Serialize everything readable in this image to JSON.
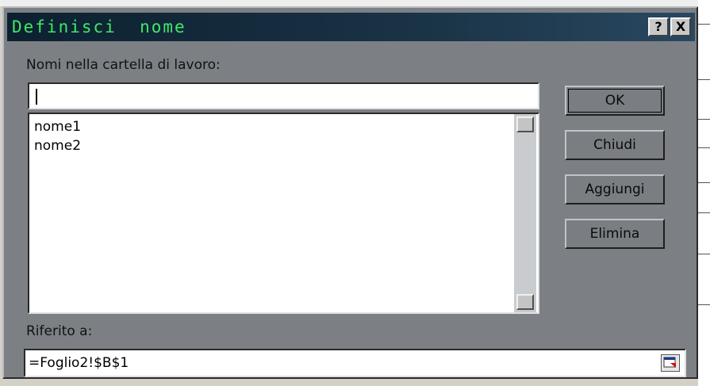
{
  "dialog": {
    "title": "Definisci  nome",
    "help_label": "?",
    "close_label": "X",
    "names_label": "Nomi nella cartella di lavoro:",
    "name_input_value": "",
    "names": [
      "nome1",
      "nome2"
    ],
    "refers_label": "Riferito a:",
    "refers_value": "=Foglio2!$B$1",
    "buttons": {
      "ok": "OK",
      "close": "Chiudi",
      "add": "Aggiungi",
      "delete": "Elimina"
    }
  },
  "colors": {
    "title_text": "#3fe86a",
    "title_bar": "#0c2030",
    "dialog_face": "#7c8084"
  },
  "icons": {
    "help": "question-mark-icon",
    "close": "close-icon",
    "scroll_up": "scroll-up-arrow-icon",
    "scroll_down": "scroll-down-arrow-icon",
    "collapse_dialog": "collapse-dialog-icon"
  }
}
